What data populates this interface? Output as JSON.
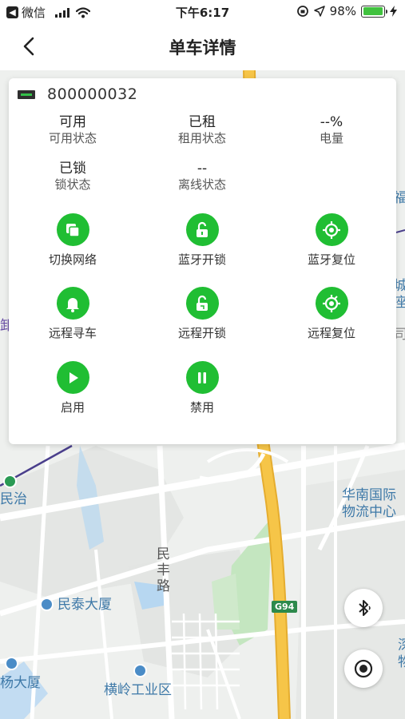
{
  "status_bar": {
    "carrier": "微信",
    "time": "下午6:17",
    "battery": "98%",
    "battery_level": 0.98
  },
  "nav": {
    "title": "单车详情"
  },
  "bike": {
    "id": "800000032"
  },
  "stats": [
    {
      "value": "可用",
      "label": "可用状态"
    },
    {
      "value": "已租",
      "label": "租用状态"
    },
    {
      "value": "--%",
      "label": "电量"
    },
    {
      "value": "已锁",
      "label": "锁状态"
    },
    {
      "value": "--",
      "label": "离线状态"
    }
  ],
  "actions": [
    {
      "label": "切换网络",
      "icon": "switch-network-icon"
    },
    {
      "label": "蓝牙开锁",
      "icon": "bluetooth-unlock-icon"
    },
    {
      "label": "蓝牙复位",
      "icon": "bluetooth-reset-icon"
    },
    {
      "label": "远程寻车",
      "icon": "bell-icon"
    },
    {
      "label": "远程开锁",
      "icon": "remote-unlock-icon"
    },
    {
      "label": "远程复位",
      "icon": "remote-reset-icon"
    },
    {
      "label": "启用",
      "icon": "play-icon"
    },
    {
      "label": "禁用",
      "icon": "pause-icon"
    }
  ],
  "map": {
    "labels": {
      "huanan": "华南国际\n物流中心",
      "minzhi": "民治",
      "minfeng": "民\n丰\n路",
      "mintai": "民泰大厦",
      "yang": "杨大厦",
      "hengling": "横岭工业区",
      "road_g94": "G94",
      "right_edge_1": "城\n座",
      "right_edge_2": "福",
      "right_edge_3": "司",
      "right_edge_4": "深\n物",
      "left_edge": "卸"
    }
  },
  "colors": {
    "accent_green": "#20be33",
    "highway_yellow": "#f6c548",
    "park_green": "#c4e6c0",
    "water_blue": "#b7d7f1",
    "poi_blue": "#3e79a8"
  }
}
